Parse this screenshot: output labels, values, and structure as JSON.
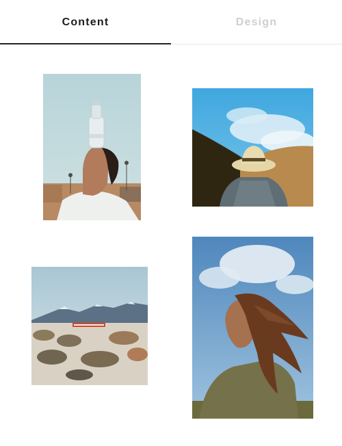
{
  "tabs": [
    {
      "label": "Content",
      "active": true
    },
    {
      "label": "Design",
      "active": false
    }
  ],
  "colors": {
    "active_tab_text": "#1c1c1c",
    "inactive_tab_text": "#cfcfcf",
    "underline": "#222222",
    "divider": "#e6e6e6",
    "background": "#ffffff"
  },
  "gallery": {
    "items": [
      {
        "subject": "man-balancing-bottle-photo"
      },
      {
        "subject": "person-in-straw-hat-photo"
      },
      {
        "subject": "desert-mountain-landscape-photo"
      },
      {
        "subject": "woman-with-windblown-hair-photo"
      }
    ]
  }
}
